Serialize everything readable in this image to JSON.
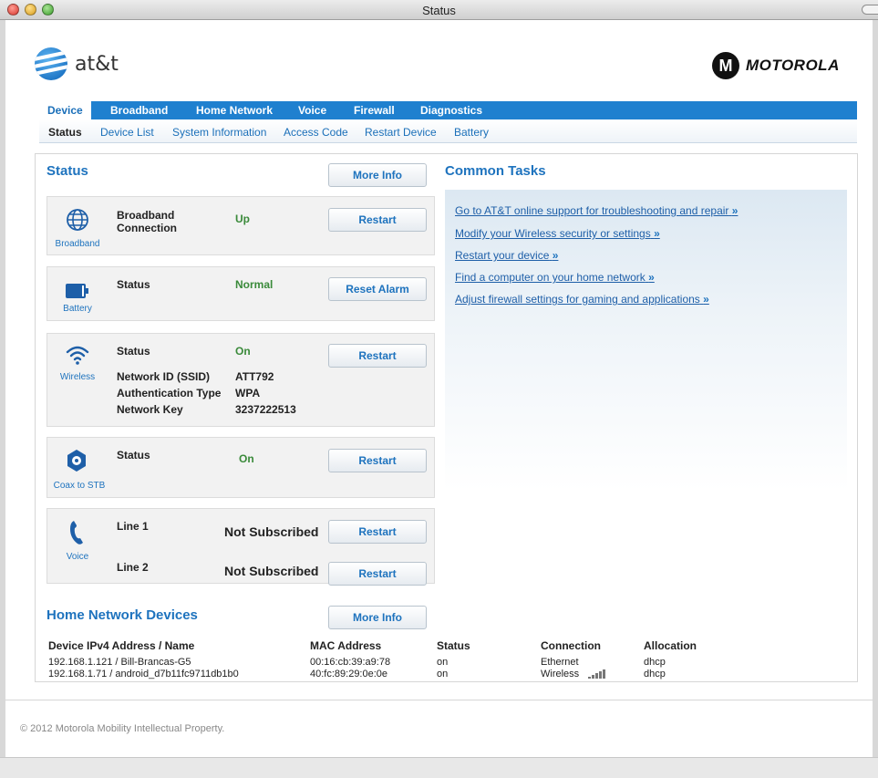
{
  "window": {
    "title": "Status"
  },
  "brand": {
    "att_text": "at&t",
    "moto_text": "MOTOROLA",
    "moto_mark": "M"
  },
  "nav": {
    "main": [
      "Device",
      "Broadband",
      "Home Network",
      "Voice",
      "Firewall",
      "Diagnostics"
    ],
    "sub": [
      "Status",
      "Device List",
      "System Information",
      "Access Code",
      "Restart Device",
      "Battery"
    ]
  },
  "status": {
    "title": "Status",
    "more_info": "More Info",
    "broadband": {
      "caption": "Broadband",
      "label": "Broadband Connection",
      "value": "Up",
      "button": "Restart"
    },
    "battery": {
      "caption": "Battery",
      "label": "Status",
      "value": "Normal",
      "button": "Reset Alarm"
    },
    "wireless": {
      "caption": "Wireless",
      "status_label": "Status",
      "status_value": "On",
      "button": "Restart",
      "ssid_label": "Network ID (SSID)",
      "ssid_value": "ATT792",
      "auth_label": "Authentication Type",
      "auth_value": "WPA",
      "key_label": "Network Key",
      "key_value": "3237222513"
    },
    "coax": {
      "caption": "Coax to STB",
      "label": "Status",
      "value": "On",
      "button": "Restart"
    },
    "voice": {
      "caption": "Voice",
      "line1_label": "Line 1",
      "line1_value": "Not Subscribed",
      "line1_button": "Restart",
      "line2_label": "Line 2",
      "line2_value": "Not Subscribed",
      "line2_button": "Restart"
    }
  },
  "tasks": {
    "title": "Common Tasks",
    "links": [
      "Go to AT&T online support for troubleshooting and repair",
      "Modify your Wireless security or settings",
      "Restart your device",
      "Find a computer on your home network",
      "Adjust firewall settings for gaming and applications"
    ],
    "arrow": "»"
  },
  "devices": {
    "title": "Home Network Devices",
    "more_info": "More Info",
    "headers": [
      "Device IPv4 Address / Name",
      "MAC Address",
      "Status",
      "Connection",
      "Allocation"
    ],
    "rows": [
      [
        "192.168.1.121 / Bill-Brancas-G5",
        "00:16:cb:39:a9:78",
        "on",
        "Ethernet",
        "dhcp"
      ],
      [
        "192.168.1.71 / android_d7b11fc9711db1b0",
        "40:fc:89:29:0e:0e",
        "on",
        "Wireless",
        "dhcp"
      ]
    ]
  },
  "footer": "© 2012 Motorola Mobility Intellectual Property.",
  "colors": {
    "accent": "#1e73be",
    "nav": "#1f80cf",
    "ok": "#3a8a3a"
  }
}
